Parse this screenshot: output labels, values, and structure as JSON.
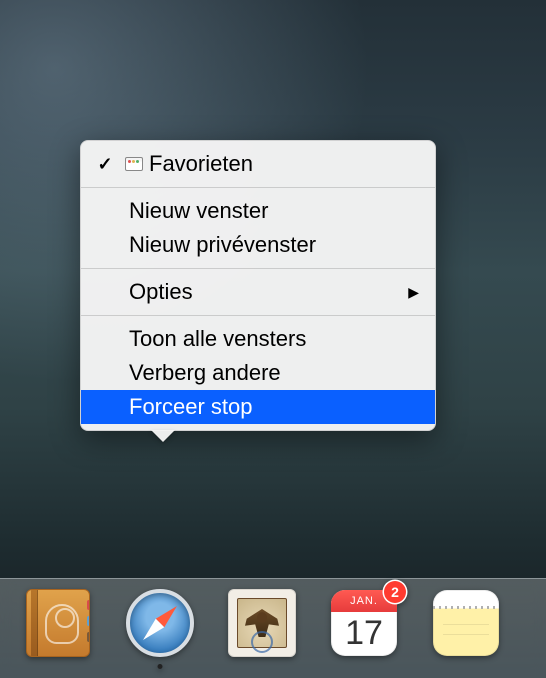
{
  "menu": {
    "favorieten": {
      "label": "Favorieten",
      "checked": true
    },
    "new_window": "Nieuw venster",
    "new_private_window": "Nieuw privévenster",
    "options": "Opties",
    "show_all_windows": "Toon alle vensters",
    "hide_others": "Verberg andere",
    "force_quit": "Forceer stop"
  },
  "dock": {
    "contacts": {
      "name": "Contacts"
    },
    "safari": {
      "name": "Safari",
      "running": true
    },
    "mail": {
      "name": "Mail"
    },
    "calendar": {
      "name": "Calendar",
      "month": "JAN.",
      "day": "17",
      "badge": "2"
    },
    "notes": {
      "name": "Notes"
    }
  }
}
